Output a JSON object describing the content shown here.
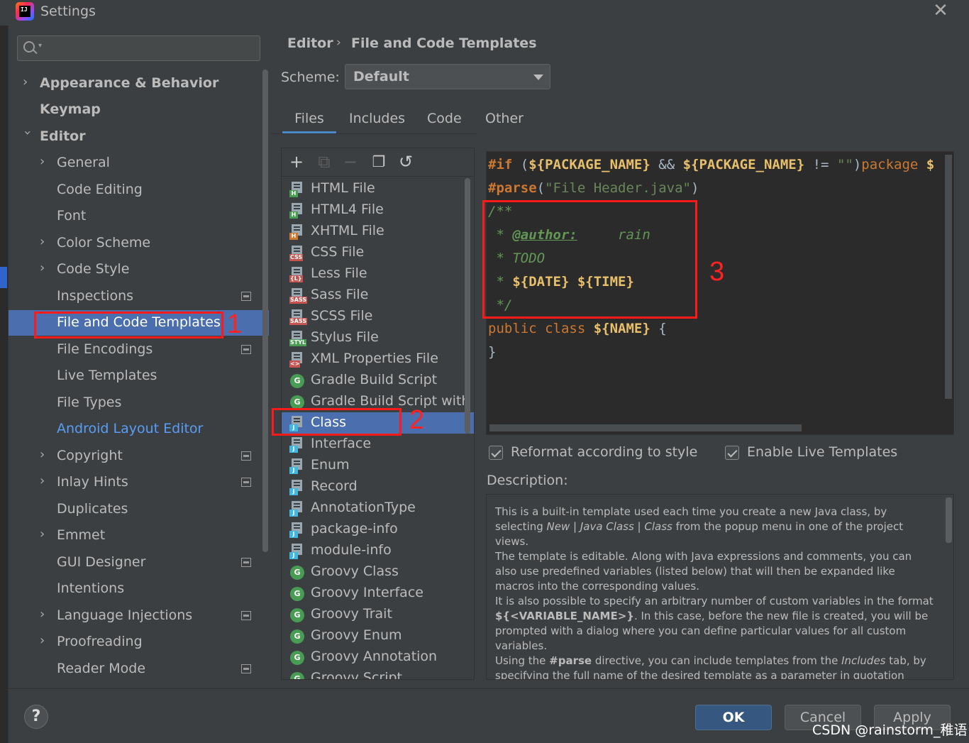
{
  "window": {
    "title": "Settings"
  },
  "search": {
    "placeholder": ""
  },
  "sidebar": {
    "items": [
      {
        "label": "Appearance & Behavior"
      },
      {
        "label": "Keymap"
      },
      {
        "label": "Editor"
      },
      {
        "label": "General"
      },
      {
        "label": "Code Editing"
      },
      {
        "label": "Font"
      },
      {
        "label": "Color Scheme"
      },
      {
        "label": "Code Style"
      },
      {
        "label": "Inspections"
      },
      {
        "label": "File and Code Templates"
      },
      {
        "label": "File Encodings"
      },
      {
        "label": "Live Templates"
      },
      {
        "label": "File Types"
      },
      {
        "label": "Android Layout Editor"
      },
      {
        "label": "Copyright"
      },
      {
        "label": "Inlay Hints"
      },
      {
        "label": "Duplicates"
      },
      {
        "label": "Emmet"
      },
      {
        "label": "GUI Designer"
      },
      {
        "label": "Intentions"
      },
      {
        "label": "Language Injections"
      },
      {
        "label": "Proofreading"
      },
      {
        "label": "Reader Mode"
      }
    ]
  },
  "annotations": {
    "n1": "1",
    "n2": "2",
    "n3": "3"
  },
  "breadcrumb": {
    "part1": "Editor",
    "part2": "File and Code Templates"
  },
  "scheme": {
    "label": "Scheme:",
    "value": "Default"
  },
  "tabs": [
    {
      "label": "Files"
    },
    {
      "label": "Includes"
    },
    {
      "label": "Code"
    },
    {
      "label": "Other"
    }
  ],
  "templates": [
    {
      "name": "HTML File",
      "badge": "H"
    },
    {
      "name": "HTML4 File",
      "badge": "H"
    },
    {
      "name": "XHTML File",
      "badge": "H"
    },
    {
      "name": "CSS File",
      "badge": "CSS"
    },
    {
      "name": "Less File",
      "badge": "{L}"
    },
    {
      "name": "Sass File",
      "badge": "SASS"
    },
    {
      "name": "SCSS File",
      "badge": "SASS"
    },
    {
      "name": "Stylus File",
      "badge": "STYL"
    },
    {
      "name": "XML Properties File",
      "badge": "<>"
    },
    {
      "name": "Gradle Build Script",
      "badge": "G"
    },
    {
      "name": "Gradle Build Script with wr",
      "badge": "G"
    },
    {
      "name": "Class",
      "badge": "J"
    },
    {
      "name": "Interface",
      "badge": "J"
    },
    {
      "name": "Enum",
      "badge": "J"
    },
    {
      "name": "Record",
      "badge": "J"
    },
    {
      "name": "AnnotationType",
      "badge": "J"
    },
    {
      "name": "package-info",
      "badge": "J"
    },
    {
      "name": "module-info",
      "badge": "J"
    },
    {
      "name": "Groovy Class",
      "badge": "G"
    },
    {
      "name": "Groovy Interface",
      "badge": "G"
    },
    {
      "name": "Groovy Trait",
      "badge": "G"
    },
    {
      "name": "Groovy Enum",
      "badge": "G"
    },
    {
      "name": "Groovy Annotation",
      "badge": "G"
    },
    {
      "name": "Groovy Script",
      "badge": "G"
    }
  ],
  "toolbar": {
    "add": "+",
    "copy_disabled": "⧉",
    "remove": "−",
    "duplicate": "❐",
    "reset": "↺"
  },
  "code": {
    "l1_if": "#if",
    "l1_a": " (",
    "l1_v1": "${PACKAGE_NAME}",
    "l1_and": " && ",
    "l1_v2": "${PACKAGE_NAME}",
    "l1_ne": " != ",
    "l1_str": "\"\"",
    "l1_close": ")",
    "l1_pkg": "package",
    "l1_tail": " $",
    "l2_parse": "#parse",
    "l2_open": "(",
    "l2_str": "\"File Header.java\"",
    "l2_close": ")",
    "l3": "/**",
    "l4_star": " * ",
    "l4_tag": "@author:",
    "l4_val": "     rain",
    "l5": " * TODO",
    "l6_star": " * ",
    "l6_v1": "${DATE}",
    "l6_sp": " ",
    "l6_v2": "${TIME}",
    "l7": " */",
    "l8_kw": "public class",
    "l8_sp": " ",
    "l8_name": "${NAME}",
    "l8_brace": " {",
    "l9": "}"
  },
  "options": {
    "reformat": "Reformat according to style",
    "live_templates": "Enable Live Templates"
  },
  "description": {
    "label": "Description:",
    "p1a": "This is a built-in template used each time you create a new Java class, by selecting ",
    "p1b": "New",
    "p1c": " | ",
    "p1d": "Java Class",
    "p1e": " | ",
    "p1f": "Class",
    "p1g": " from the popup menu in one of the project views.",
    "p2": "The template is editable. Along with Java expressions and comments, you can also use predefined variables (listed below) that will then be expanded like macros into the corresponding values.",
    "p3a": "It is also possible to specify an arbitrary number of custom variables in the format ",
    "p3b": "${<VARIABLE_NAME>}",
    "p3c": ". In this case, before the new file is created, you will be prompted with a dialog where you can define particular values for all custom variables.",
    "p4a": "Using the ",
    "p4b": "#parse",
    "p4c": " directive, you can include templates from the ",
    "p4d": "Includes",
    "p4e": " tab, by specifying the full name of the desired template as a parameter in quotation"
  },
  "footer": {
    "help": "?",
    "ok": "OK",
    "cancel": "Cancel",
    "apply": "Apply"
  },
  "watermark": "CSDN @rainstorm_稚语",
  "colors": {
    "selection": "#4b6eaf",
    "annotation_red": "#ff1a1a",
    "primary_button": "#365880",
    "link": "#589df6"
  }
}
